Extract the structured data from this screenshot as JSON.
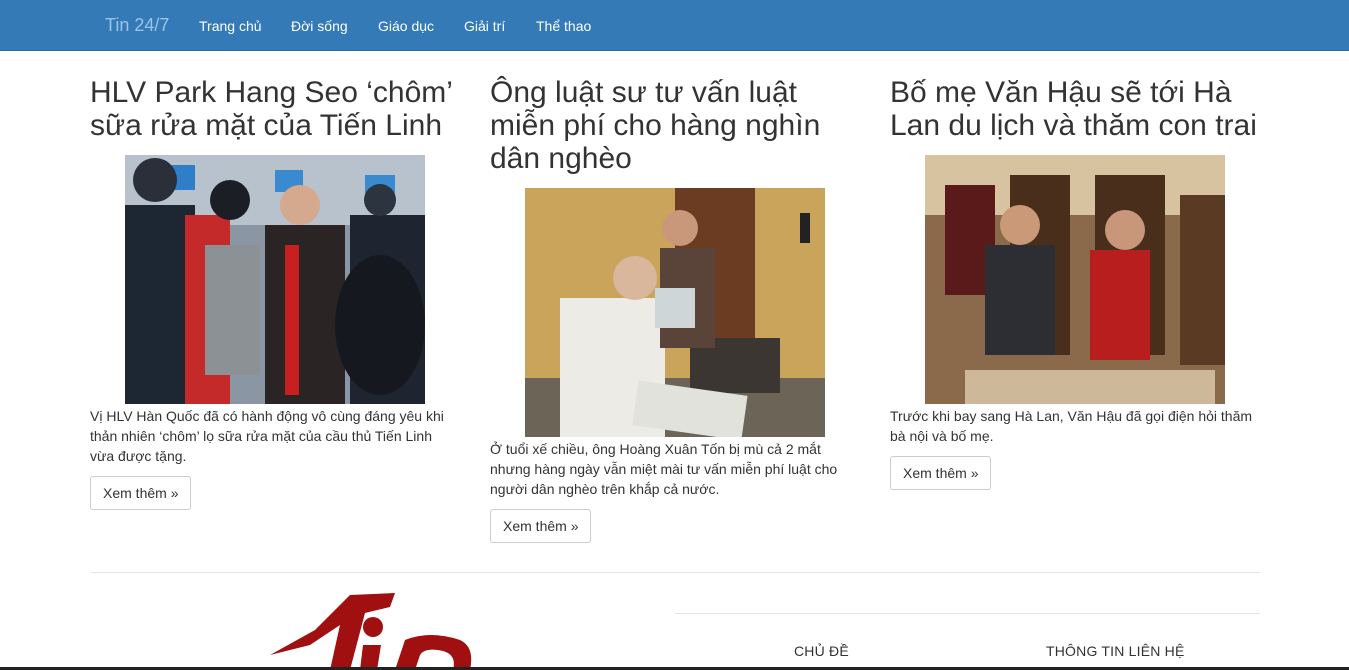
{
  "nav": {
    "brand": "Tin 24/7",
    "items": [
      "Trang chủ",
      "Đời sống",
      "Giáo dục",
      "Giải trí",
      "Thể thao"
    ]
  },
  "articles": [
    {
      "title": "HLV Park Hang Seo ‘chôm’ sữa rửa mặt của Tiến Linh",
      "summary": "Vị HLV Hàn Quốc đã có hành động vô cùng đáng yêu khi thản nhiên ‘chôm’ lọ sữa rửa mặt của cầu thủ Tiến Linh vừa được tặng.",
      "button": "Xem thêm »"
    },
    {
      "title": "Ông luật sư tư vấn luật miễn phí cho hàng nghìn dân nghèo",
      "summary": "Ở tuổi xế chiều, ông Hoàng Xuân Tốn bị mù cả 2 mắt nhưng hàng ngày vẫn miệt mài tư vấn miễn phí luật cho người dân nghèo trên khắp cả nước.",
      "button": "Xem thêm »"
    },
    {
      "title": "Bố mẹ Văn Hậu sẽ tới Hà Lan du lịch và thăm con trai",
      "summary": "Trước khi bay sang Hà Lan, Văn Hậu đã gọi điện hỏi thăm bà nội và bố mẹ.",
      "button": "Xem thêm »"
    }
  ],
  "footer": {
    "topics_heading": "CHỦ ĐỀ",
    "contact_heading": "THÔNG TIN LIÊN HỆ"
  },
  "colors": {
    "navbar": "#337ab7",
    "logo": "#a01010"
  }
}
